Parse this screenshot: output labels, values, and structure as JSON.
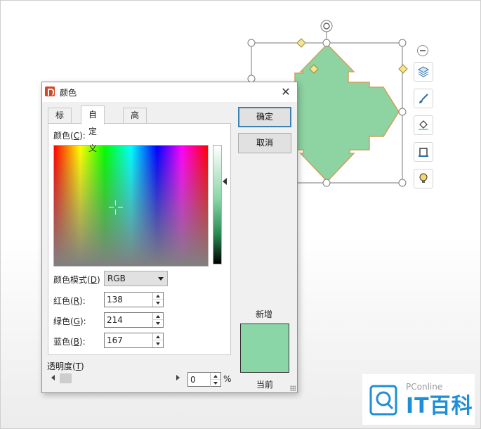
{
  "dialog": {
    "title": "颜色",
    "tabs": [
      {
        "label": "标准",
        "active": false
      },
      {
        "label": "自定义",
        "active": true
      },
      {
        "label": "高级",
        "active": false
      }
    ],
    "color_label_main": "颜色(",
    "color_label_key": "C",
    "color_label_end": "):",
    "color_mode": {
      "label_main": "颜色模式(",
      "label_key": "D",
      "label_end": ")",
      "value": "RGB"
    },
    "red": {
      "label_main": "红色(",
      "label_key": "R",
      "label_end": "):",
      "value": "138"
    },
    "green": {
      "label_main": "绿色(",
      "label_key": "G",
      "label_end": "):",
      "value": "214"
    },
    "blue": {
      "label_main": "蓝色(",
      "label_key": "B",
      "label_end": "):",
      "value": "167"
    },
    "transparency": {
      "label_main": "透明度(",
      "label_key": "T",
      "label_end": ")",
      "value": "0",
      "unit": "%"
    },
    "ok_label": "确定",
    "cancel_label": "取消",
    "new_label": "新增",
    "current_label": "当前",
    "selected_color": "#8ad6a7"
  },
  "shape": {
    "fill": "#8ed3a2",
    "stroke": "#d0a15a"
  },
  "watermark": {
    "brand": "PConline",
    "name": "IT百科"
  }
}
